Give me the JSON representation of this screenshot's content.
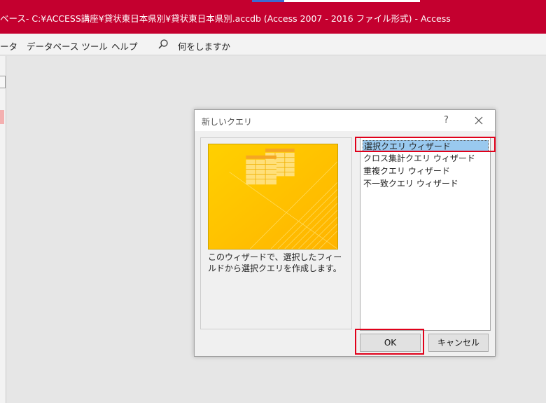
{
  "window": {
    "title": "ベース- C:¥ACCESS講座¥貸状東日本県別¥貸状東日本県別.accdb (Access 2007 - 2016 ファイル形式)  -  Access",
    "titlebar_color": "#c4002f"
  },
  "menu": {
    "items": [
      "ータ",
      "データベース ツール",
      "ヘルプ"
    ],
    "search_placeholder": "何をしますか",
    "search_icon": "search-icon"
  },
  "dialog": {
    "title": "新しいクエリ",
    "help_label": "?",
    "close_icon": "close-icon",
    "description": "このウィザードで、選択したフィールドから選択クエリを作成します。",
    "options": [
      "選択クエリ ウィザード",
      "クロス集計クエリ ウィザード",
      "重複クエリ ウィザード",
      "不一致クエリ ウィザード"
    ],
    "selected_option": "選択クエリ ウィザード",
    "ok_label": "OK",
    "cancel_label": "キャンセル",
    "highlight_color": "#e0001a",
    "preview_colors": {
      "background": "#ffc000",
      "grid": "#ffe07a",
      "header": "#f5a623"
    }
  }
}
